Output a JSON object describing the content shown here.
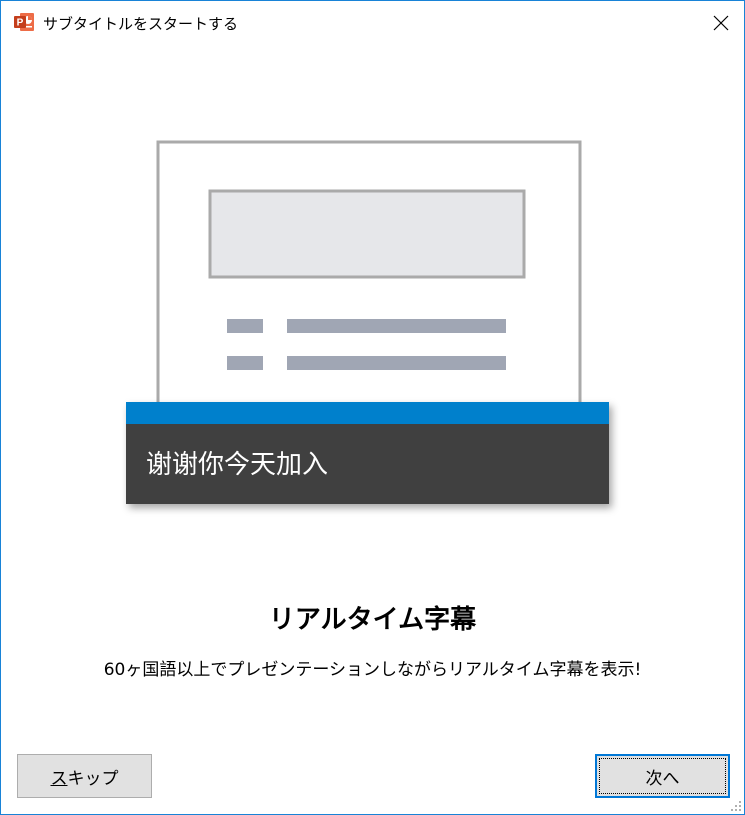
{
  "window": {
    "title": "サブタイトルをスタートする"
  },
  "colors": {
    "accent": "#0080cc",
    "caption_bg": "#404040",
    "slide_border": "#aaaaaa",
    "line_color": "#a0a6b4",
    "title_box": "#e6e7ea"
  },
  "illustration": {
    "caption_text": "谢谢你今天加入"
  },
  "content": {
    "heading": "リアルタイム字幕",
    "description": "60ヶ国語以上でプレゼンテーションしながらリアルタイム字幕を表示!"
  },
  "buttons": {
    "skip_label": "スキップ",
    "next_label": "次へ"
  }
}
